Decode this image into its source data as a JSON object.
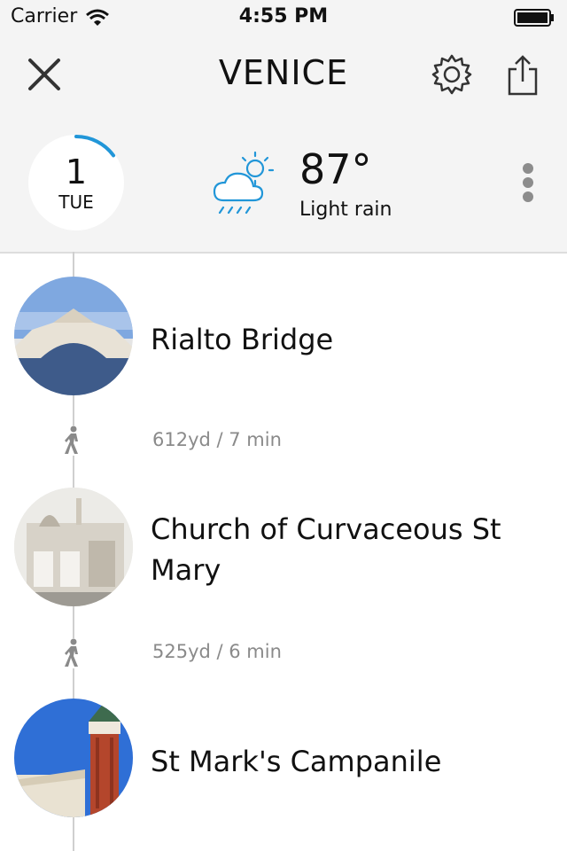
{
  "status_bar": {
    "carrier": "Carrier",
    "time": "4:55 PM"
  },
  "nav": {
    "title": "VENICE",
    "close_icon": "close-icon",
    "settings_icon": "gear-icon",
    "share_icon": "share-icon"
  },
  "day": {
    "number": "1",
    "weekday": "TUE",
    "progress": 0.15
  },
  "weather": {
    "icon": "cloud-rain-sun-icon",
    "temperature": "87°",
    "condition": "Light rain"
  },
  "more_icon": "more-vertical-icon",
  "colors": {
    "accent": "#2196d8",
    "header_bg": "#f4f4f4",
    "secondary_text": "#8a8a8a"
  },
  "itinerary": [
    {
      "name": "Rialto Bridge"
    },
    {
      "walk": "612yd / 7 min"
    },
    {
      "name": "Church of Curvaceous St Mary"
    },
    {
      "walk": "525yd / 6 min"
    },
    {
      "name": "St Mark's Campanile"
    }
  ]
}
